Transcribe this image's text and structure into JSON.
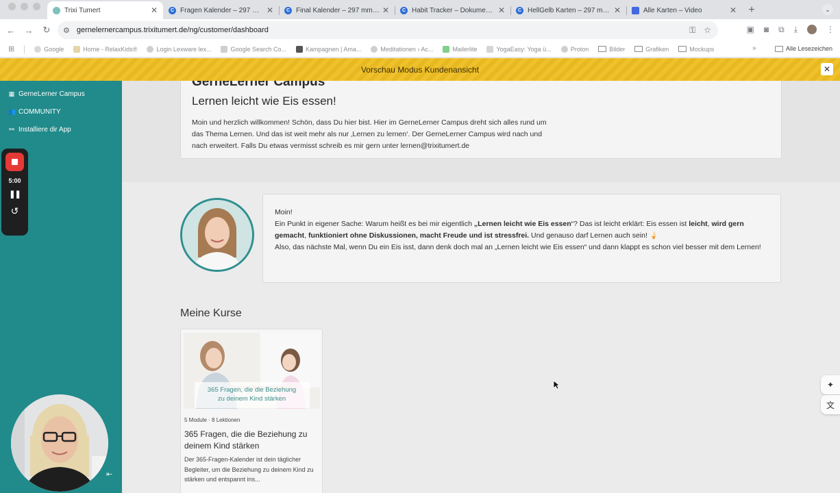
{
  "browser": {
    "tabs": [
      {
        "title": "Trixi Tumert",
        "icon": "trixi-favicon",
        "active": true
      },
      {
        "title": "Fragen Kalender – 297 mm ×",
        "icon": "canva-favicon",
        "active": false
      },
      {
        "title": "Final Kalender – 297 mm × 2",
        "icon": "canva-favicon",
        "active": false
      },
      {
        "title": "Habit Tracker – Dokument (A",
        "icon": "canva-favicon",
        "active": false
      },
      {
        "title": "HellGelb Karten – 297 mm ×",
        "icon": "canva-favicon",
        "active": false
      },
      {
        "title": "Alle Karten – Video",
        "icon": "video-favicon",
        "active": false
      }
    ],
    "url": "gernelernercampus.trixitumert.de/ng/customer/dashboard",
    "bookmarks": [
      "Google",
      "Home - RelaxKids®",
      "Login Lexware lex...",
      "Google Search Co...",
      "Kampagnen | Ama...",
      "Meditationen › Ac...",
      "Mailerlite",
      "YogaEasy: Yoga ü...",
      "Proton",
      "Bilder",
      "Grafiken",
      "Mockups"
    ],
    "bookmarks_all": "Alle Lesezeichen"
  },
  "banner": {
    "text": "Vorschau Modus Kundenansicht"
  },
  "sidebar": {
    "items": [
      {
        "label": "GerneLerner Campus",
        "icon": "grid-icon"
      },
      {
        "label": "COMMUNITY",
        "icon": "users-icon"
      },
      {
        "label": "Installiere dir App",
        "icon": "link-icon"
      }
    ]
  },
  "recorder": {
    "time": "5:00"
  },
  "welcome": {
    "title": "GerneLerner Campus",
    "slogan": "Lernen leicht wie Eis essen!",
    "lines": [
      "Moin und herzlich willkommen!  Schön, dass Du hier bist. Hier im GerneLerner Campus dreht sich alles rund um",
      "das Thema Lernen. Und das ist weit mehr als nur ‚Lernen zu lernen‘. Der GerneLerner Campus wird nach und",
      "nach erweitert.  Falls Du etwas vermisst schreib es mir gern unter lernen@trixitumert.de"
    ]
  },
  "info": {
    "greeting": "Moin!",
    "p1_a": "Ein Punkt in eigener Sache: Warum heißt es bei mir eigentlich ",
    "p1_bold1": "„Lernen leicht wie Eis essen",
    "p1_b": "“? Das ist leicht erklärt: Eis essen ist ",
    "p1_bold2": "leicht",
    "p1_c": ", ",
    "p1_bold3": "wird gern gemacht",
    "p1_d": ", ",
    "p1_bold4": "funktioniert ohne Diskussionen, macht Freude und ist stressfrei.",
    "p1_e": " Und genauso darf Lernen auch sein! 🍦",
    "p2": "Also, das nächste Mal, wenn Du ein Eis isst, dann denk doch mal an „Lernen leicht wie Eis essen“ und dann klappt es schon viel besser mit dem Lernen!"
  },
  "courses": {
    "heading": "Meine Kurse",
    "items": [
      {
        "thumb_caption_1": "365 Fragen, die die Beziehung",
        "thumb_caption_2": "zu deinem Kind stärken",
        "modules": "5 Module",
        "lessons": "8 Lektionen",
        "title": "365 Fragen, die die Beziehung zu deinem Kind stärken",
        "description": "Der 365-Fragen-Kalender ist dein täglicher Begleiter, um die Beziehung zu deinem Kind zu stärken und entspannt ins..."
      }
    ]
  },
  "colors": {
    "sidebar": "#218a8a",
    "banner": "#efc12d",
    "accent": "#2f8f8f"
  }
}
